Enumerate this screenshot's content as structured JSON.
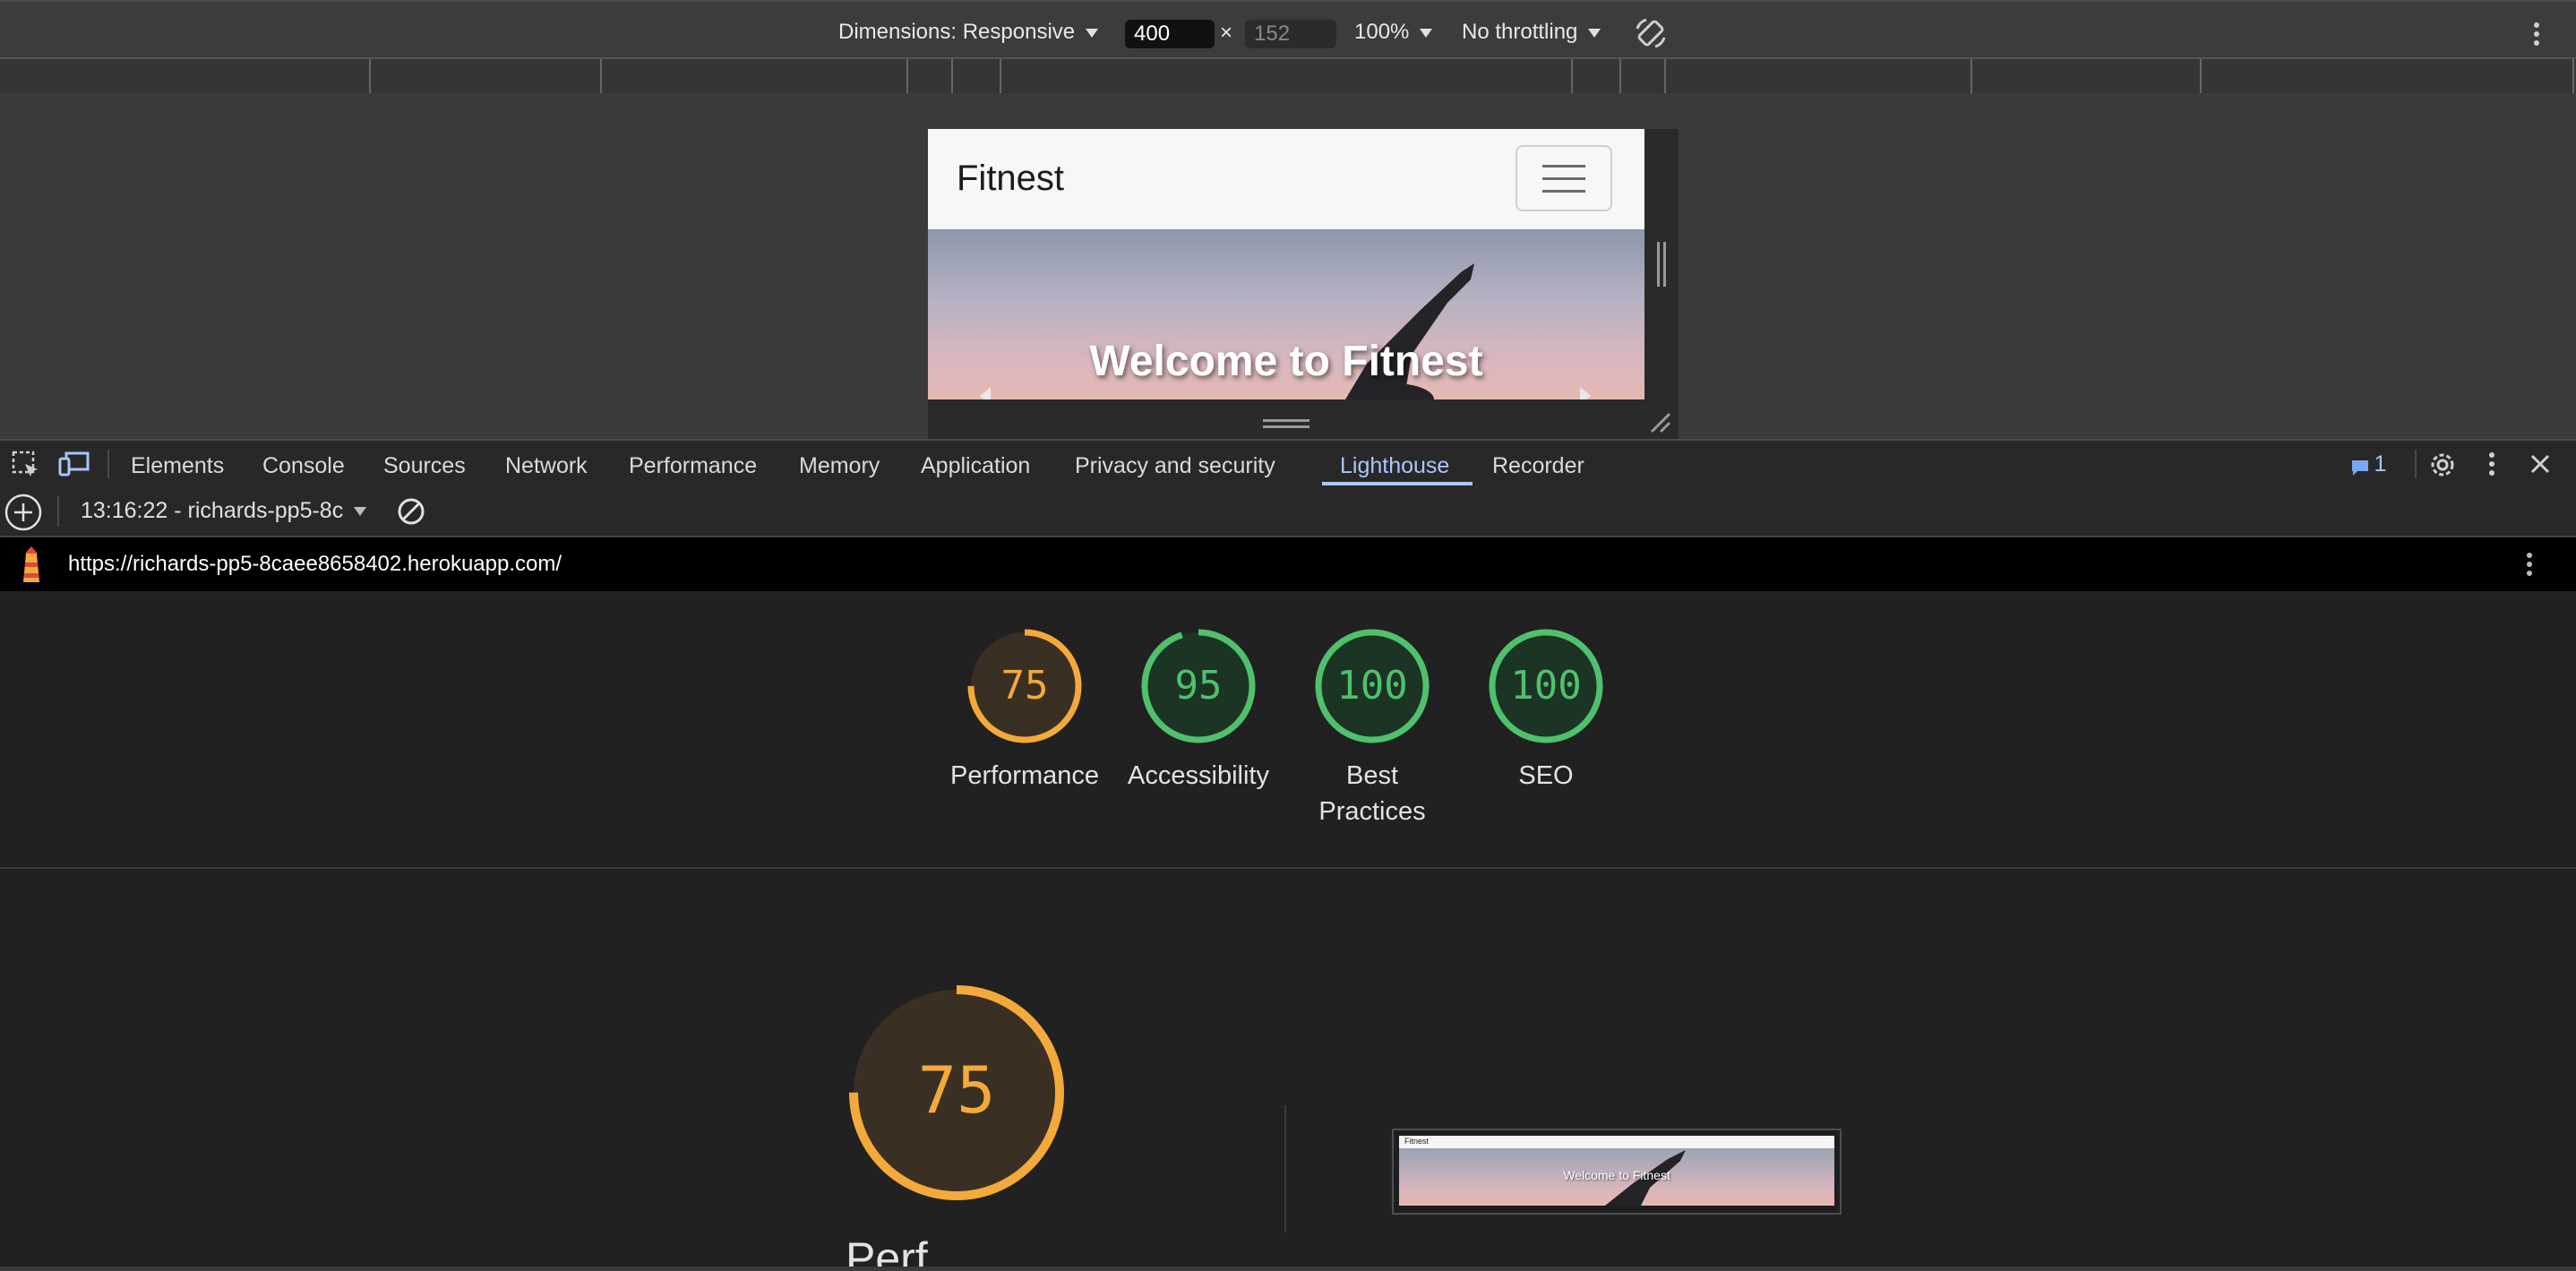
{
  "device_toolbar": {
    "dimensions_label": "Dimensions: Responsive",
    "width_value": "400",
    "times": "×",
    "height_placeholder": "152",
    "zoom": "100%",
    "throttling": "No throttling"
  },
  "site": {
    "brand": "Fitnest",
    "hero_title": "Welcome to Fitnest"
  },
  "devtools_tabs": [
    "Elements",
    "Console",
    "Sources",
    "Network",
    "Performance",
    "Memory",
    "Application",
    "Privacy and security",
    "Lighthouse",
    "Recorder"
  ],
  "active_tab": "Lighthouse",
  "issues_count": "1",
  "lighthouse": {
    "report_selector": "13:16:22 - richards-pp5-8c",
    "url": "https://richards-pp5-8caee8658402.herokuapp.com/",
    "scores": [
      {
        "label_line1": "Performance",
        "label_line2": "",
        "score": "75",
        "value": 75,
        "color": "#f4a93b"
      },
      {
        "label_line1": "Accessibility",
        "label_line2": "",
        "score": "95",
        "value": 95,
        "color": "#4fc16d"
      },
      {
        "label_line1": "Best",
        "label_line2": "Practices",
        "score": "100",
        "value": 100,
        "color": "#4fc16d"
      },
      {
        "label_line1": "SEO",
        "label_line2": "",
        "score": "100",
        "value": 100,
        "color": "#4fc16d"
      }
    ],
    "main_score": {
      "score": "75",
      "value": 75,
      "color": "#f4a93b",
      "title_partial": "Perf"
    },
    "thumbnail": {
      "brand": "Fitnest",
      "title": "Welcome to Fitnest"
    }
  }
}
